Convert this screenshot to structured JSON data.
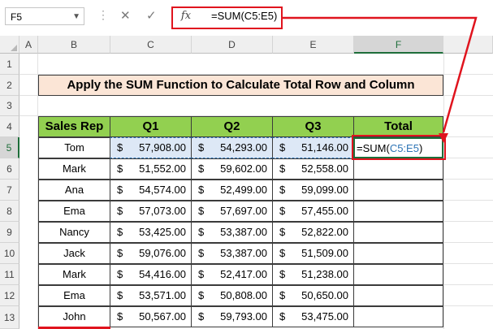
{
  "formula_bar": {
    "name_box": "F5",
    "formula": "=SUM(C5:E5)",
    "fx_label": "fx",
    "cancel_icon": "close-icon",
    "enter_icon": "check-icon"
  },
  "columns": [
    "A",
    "B",
    "C",
    "D",
    "E",
    "F"
  ],
  "rows": [
    "1",
    "2",
    "3",
    "4",
    "5",
    "6",
    "7",
    "8",
    "9",
    "10",
    "11",
    "12",
    "13"
  ],
  "title": "Apply the SUM Function to Calculate Total Row and Column",
  "table": {
    "headers": [
      "Sales Rep",
      "Q1",
      "Q2",
      "Q3",
      "Total"
    ],
    "currency": "$",
    "rows": [
      {
        "rep": "Tom",
        "q1": "57,908.00",
        "q2": "54,293.00",
        "q3": "51,146.00"
      },
      {
        "rep": "Mark",
        "q1": "51,552.00",
        "q2": "59,602.00",
        "q3": "52,558.00"
      },
      {
        "rep": "Ana",
        "q1": "54,574.00",
        "q2": "52,499.00",
        "q3": "59,099.00"
      },
      {
        "rep": "Ema",
        "q1": "57,073.00",
        "q2": "57,697.00",
        "q3": "57,455.00"
      },
      {
        "rep": "Nancy",
        "q1": "53,425.00",
        "q2": "53,387.00",
        "q3": "52,822.00"
      },
      {
        "rep": "Jack",
        "q1": "59,076.00",
        "q2": "53,387.00",
        "q3": "51,509.00"
      },
      {
        "rep": "Mark",
        "q1": "54,416.00",
        "q2": "52,417.00",
        "q3": "51,238.00"
      },
      {
        "rep": "Ema",
        "q1": "53,571.00",
        "q2": "50,808.00",
        "q3": "50,650.00"
      },
      {
        "rep": "John",
        "q1": "50,567.00",
        "q2": "59,793.00",
        "q3": "53,475.00"
      }
    ]
  },
  "active_cell_formula": {
    "prefix": "=SUM(",
    "range": "C5:E5",
    "suffix": ")"
  },
  "accent_colors": {
    "header_green": "#92d050",
    "title_peach": "#fbe5d6",
    "callout_red": "#e0141e",
    "selection_blue": "#dde8f6"
  }
}
